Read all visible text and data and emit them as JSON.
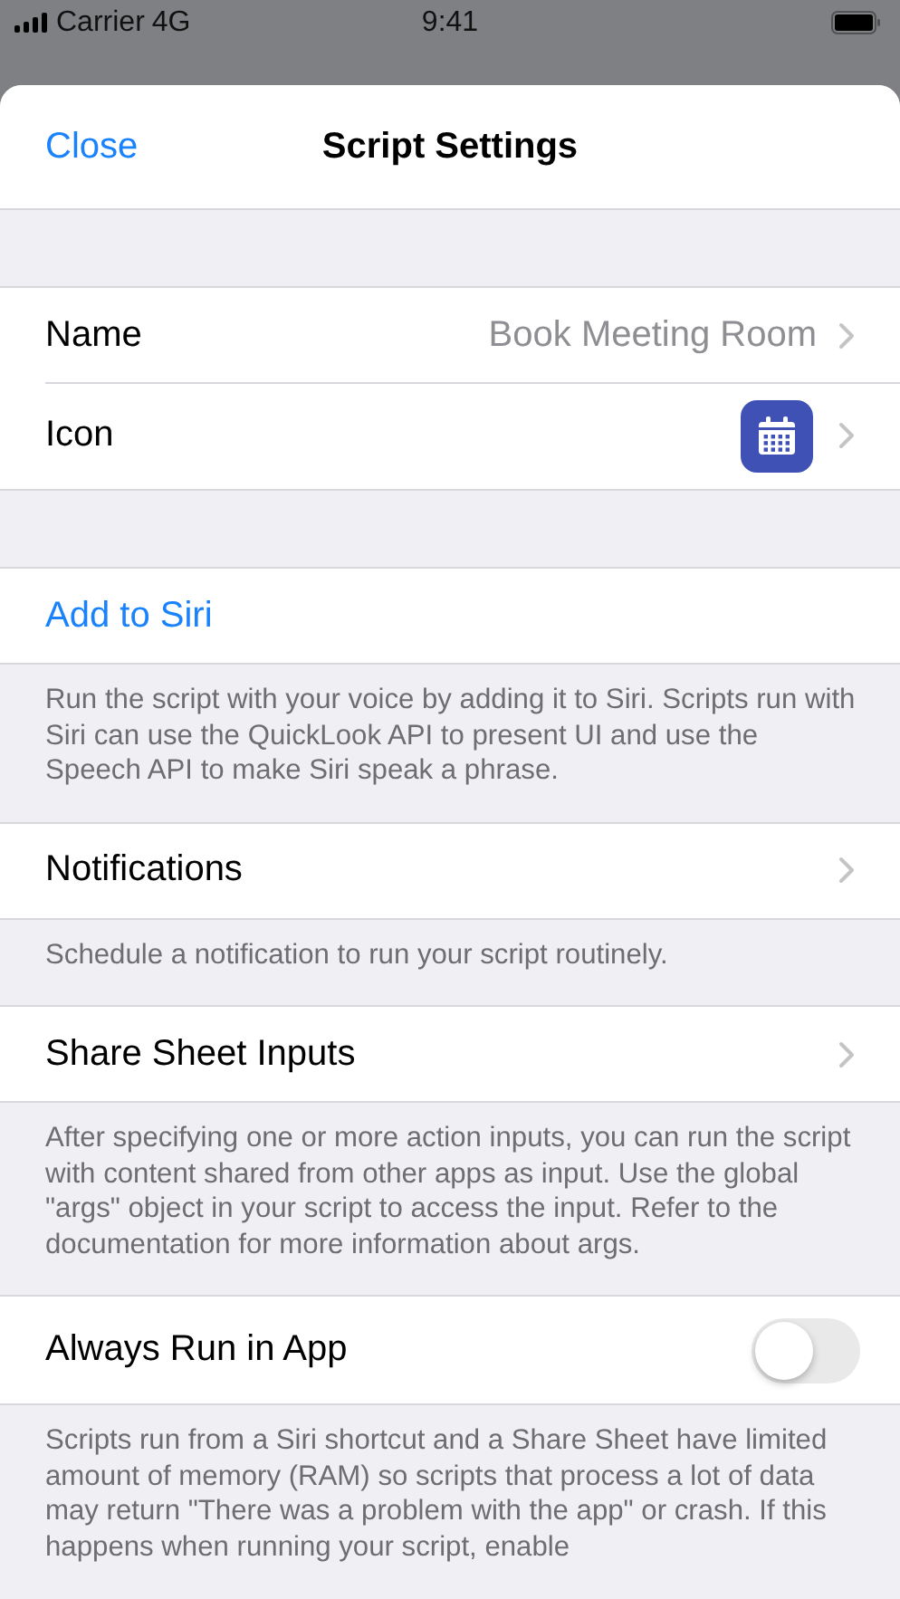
{
  "status_bar": {
    "carrier": "Carrier",
    "network": "4G",
    "time": "9:41"
  },
  "nav": {
    "close": "Close",
    "title": "Script Settings"
  },
  "sections": [
    {
      "rows": [
        {
          "kind": "value",
          "label": "Name",
          "value": "Book Meeting Room"
        },
        {
          "kind": "icon",
          "label": "Icon"
        }
      ]
    },
    {
      "rows": [
        {
          "kind": "action",
          "label": "Add to Siri"
        }
      ],
      "footer": "Run the script with your voice by adding it to Siri. Scripts run with Siri can use the QuickLook API to present UI and use the Speech API to make Siri speak a phrase."
    },
    {
      "rows": [
        {
          "kind": "link",
          "label": "Notifications"
        }
      ],
      "footer": "Schedule a notification to run your script routinely."
    },
    {
      "rows": [
        {
          "kind": "link",
          "label": "Share Sheet Inputs"
        }
      ],
      "footer": "After specifying one or more action inputs, you can run the script with content shared from other apps as input. Use the global \"args\" object in your script to access the input. Refer to the documentation for more information about args."
    },
    {
      "rows": [
        {
          "kind": "toggle",
          "label": "Always Run in App",
          "on": false
        }
      ],
      "footer": "Scripts run from a Siri shortcut and a Share Sheet have limited amount of memory (RAM) so scripts that process a lot of data may return \"There was a problem with the app\" or crash. If this happens when running your script, enable"
    }
  ]
}
